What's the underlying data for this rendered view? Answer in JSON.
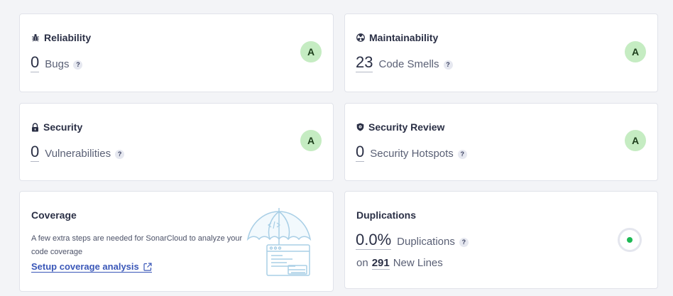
{
  "colors": {
    "rating_bg": "#c5ecc2",
    "rating_text": "#1c3d1a",
    "link": "#3a57b8",
    "dup_indicator": "#1db954"
  },
  "help_glyph": "?",
  "reliability": {
    "title": "Reliability",
    "icon": "bug-icon",
    "value": "0",
    "label": "Bugs",
    "rating": "A"
  },
  "maintainability": {
    "title": "Maintainability",
    "icon": "radiation-icon",
    "value": "23",
    "label": "Code Smells",
    "rating": "A"
  },
  "security": {
    "title": "Security",
    "icon": "lock-icon",
    "value": "0",
    "label": "Vulnerabilities",
    "rating": "A"
  },
  "security_review": {
    "title": "Security Review",
    "icon": "shield-icon",
    "value": "0",
    "label": "Security Hotspots",
    "rating": "A"
  },
  "coverage": {
    "title": "Coverage",
    "description": "A few extra steps are needed for SonarCloud to analyze your code coverage",
    "link_label": "Setup coverage analysis",
    "link_icon": "external-link-icon",
    "illustration": "umbrella-code-illustration"
  },
  "duplications": {
    "title": "Duplications",
    "value": "0.0%",
    "label": "Duplications",
    "lines_prefix": "on",
    "lines_count": "291",
    "lines_label": "New Lines"
  }
}
